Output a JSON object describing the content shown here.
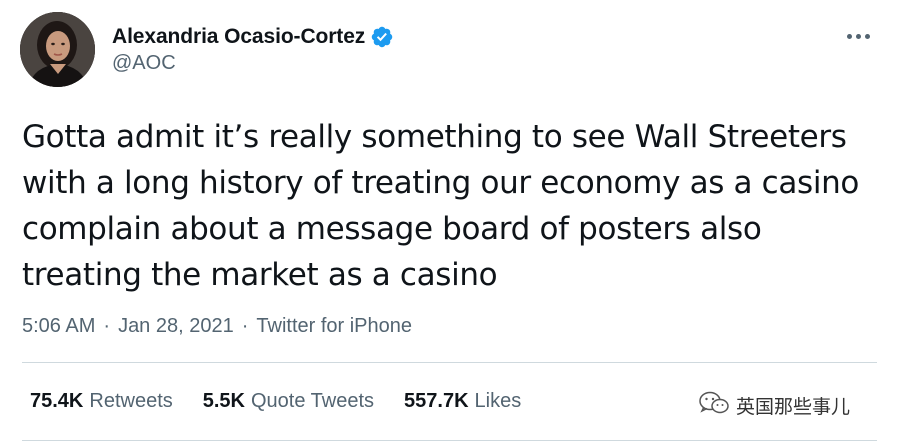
{
  "author": {
    "display_name": "Alexandria Ocasio-Cortez",
    "handle": "@AOC",
    "verified_icon": "verified-badge-icon"
  },
  "tweet": {
    "text_lines": [
      "Gotta admit it’s really something to see Wall Streeters",
      "with a long history of treating our economy as a casino",
      "complain about a message board of posters also",
      "treating the market as a casino"
    ],
    "time": "5:06 AM",
    "date": "Jan 28, 2021",
    "source": "Twitter for iPhone",
    "separator": "·"
  },
  "stats": {
    "retweets_count": "75.4K",
    "retweets_label": "Retweets",
    "quotes_count": "5.5K",
    "quotes_label": "Quote Tweets",
    "likes_count": "557.7K",
    "likes_label": "Likes"
  },
  "watermark": {
    "text": "英国那些事儿"
  },
  "colors": {
    "text": "#0f1419",
    "secondary": "#536471",
    "verified": "#1d9bf0",
    "divider": "#cfd9de"
  }
}
